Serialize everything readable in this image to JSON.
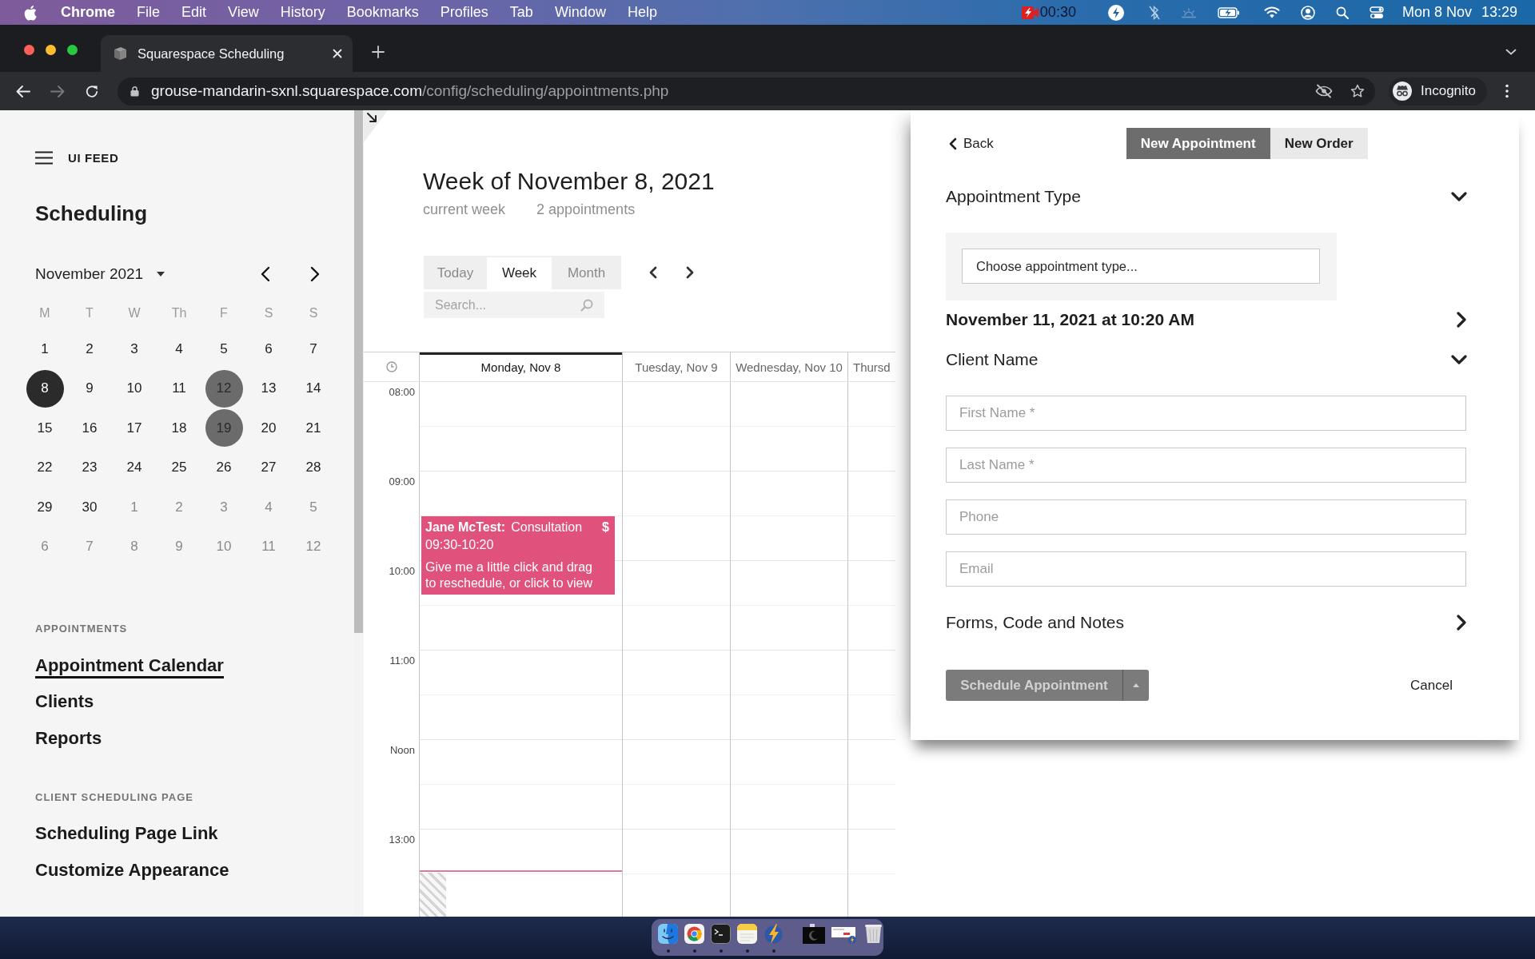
{
  "menu_bar": {
    "app": "Chrome",
    "menus": [
      "File",
      "Edit",
      "View",
      "History",
      "Bookmarks",
      "Profiles",
      "Tab",
      "Window",
      "Help"
    ],
    "recording_time": "00:30",
    "date": "Mon 8 Nov",
    "time": "13:29"
  },
  "browser": {
    "tab": {
      "title": "Squarespace Scheduling"
    },
    "url": {
      "host": "grouse-mandarin-sxnl.squarespace.com",
      "path": "/config/scheduling/appointments.php"
    },
    "profile": "Incognito"
  },
  "sidebar": {
    "brand": "UI FEED",
    "title": "Scheduling",
    "mini_calendar": {
      "month": "November 2021",
      "weekdays": [
        "M",
        "T",
        "W",
        "Th",
        "F",
        "S",
        "S"
      ],
      "weeks": [
        [
          {
            "day": "1",
            "other_month": false,
            "selected": false,
            "marked": false
          },
          {
            "day": "2",
            "other_month": false,
            "selected": false,
            "marked": false
          },
          {
            "day": "3",
            "other_month": false,
            "selected": false,
            "marked": false
          },
          {
            "day": "4",
            "other_month": false,
            "selected": false,
            "marked": false
          },
          {
            "day": "5",
            "other_month": false,
            "selected": false,
            "marked": false
          },
          {
            "day": "6",
            "other_month": false,
            "selected": false,
            "marked": false
          },
          {
            "day": "7",
            "other_month": false,
            "selected": false,
            "marked": false
          }
        ],
        [
          {
            "day": "8",
            "other_month": false,
            "selected": true,
            "marked": false
          },
          {
            "day": "9",
            "other_month": false,
            "selected": false,
            "marked": false
          },
          {
            "day": "10",
            "other_month": false,
            "selected": false,
            "marked": false
          },
          {
            "day": "11",
            "other_month": false,
            "selected": false,
            "marked": false
          },
          {
            "day": "12",
            "other_month": false,
            "selected": false,
            "marked": true
          },
          {
            "day": "13",
            "other_month": false,
            "selected": false,
            "marked": false
          },
          {
            "day": "14",
            "other_month": false,
            "selected": false,
            "marked": false
          }
        ],
        [
          {
            "day": "15",
            "other_month": false,
            "selected": false,
            "marked": false
          },
          {
            "day": "16",
            "other_month": false,
            "selected": false,
            "marked": false
          },
          {
            "day": "17",
            "other_month": false,
            "selected": false,
            "marked": false
          },
          {
            "day": "18",
            "other_month": false,
            "selected": false,
            "marked": false
          },
          {
            "day": "19",
            "other_month": false,
            "selected": false,
            "marked": true
          },
          {
            "day": "20",
            "other_month": false,
            "selected": false,
            "marked": false
          },
          {
            "day": "21",
            "other_month": false,
            "selected": false,
            "marked": false
          }
        ],
        [
          {
            "day": "22",
            "other_month": false,
            "selected": false,
            "marked": false
          },
          {
            "day": "23",
            "other_month": false,
            "selected": false,
            "marked": false
          },
          {
            "day": "24",
            "other_month": false,
            "selected": false,
            "marked": false
          },
          {
            "day": "25",
            "other_month": false,
            "selected": false,
            "marked": false
          },
          {
            "day": "26",
            "other_month": false,
            "selected": false,
            "marked": false
          },
          {
            "day": "27",
            "other_month": false,
            "selected": false,
            "marked": false
          },
          {
            "day": "28",
            "other_month": false,
            "selected": false,
            "marked": false
          }
        ],
        [
          {
            "day": "29",
            "other_month": false,
            "selected": false,
            "marked": false
          },
          {
            "day": "30",
            "other_month": false,
            "selected": false,
            "marked": false
          },
          {
            "day": "1",
            "other_month": true,
            "selected": false,
            "marked": false
          },
          {
            "day": "2",
            "other_month": true,
            "selected": false,
            "marked": false
          },
          {
            "day": "3",
            "other_month": true,
            "selected": false,
            "marked": false
          },
          {
            "day": "4",
            "other_month": true,
            "selected": false,
            "marked": false
          },
          {
            "day": "5",
            "other_month": true,
            "selected": false,
            "marked": false
          }
        ],
        [
          {
            "day": "6",
            "other_month": true,
            "selected": false,
            "marked": false
          },
          {
            "day": "7",
            "other_month": true,
            "selected": false,
            "marked": false
          },
          {
            "day": "8",
            "other_month": true,
            "selected": false,
            "marked": false
          },
          {
            "day": "9",
            "other_month": true,
            "selected": false,
            "marked": false
          },
          {
            "day": "10",
            "other_month": true,
            "selected": false,
            "marked": false
          },
          {
            "day": "11",
            "other_month": true,
            "selected": false,
            "marked": false
          },
          {
            "day": "12",
            "other_month": true,
            "selected": false,
            "marked": false
          }
        ]
      ]
    },
    "sections": [
      {
        "heading": "APPOINTMENTS",
        "items": [
          {
            "label": "Appointment Calendar",
            "selected": true
          },
          {
            "label": "Clients",
            "selected": false
          },
          {
            "label": "Reports",
            "selected": false
          }
        ]
      },
      {
        "heading": "CLIENT SCHEDULING PAGE",
        "items": [
          {
            "label": "Scheduling Page Link",
            "selected": false
          },
          {
            "label": "Customize Appearance",
            "selected": false
          }
        ]
      }
    ]
  },
  "calendar": {
    "title": "Week of November 8, 2021",
    "status": "current week",
    "count": "2 appointments",
    "views": [
      {
        "label": "Today",
        "selected": false
      },
      {
        "label": "Week",
        "selected": true
      },
      {
        "label": "Month",
        "selected": false
      }
    ],
    "search": {
      "placeholder": "Search..."
    },
    "days": [
      {
        "label": "Monday, Nov 8",
        "selected": true,
        "events": [
          {
            "client": "Jane McTest:",
            "service": "Consultation",
            "price_mark": "$",
            "time": "09:30-10:20",
            "note": "Give me a little click and drag to reschedule, or click to view"
          }
        ]
      },
      {
        "label": "Tuesday, Nov 9",
        "selected": false
      },
      {
        "label": "Wednesday, Nov 10",
        "selected": false
      },
      {
        "label": "Thursd",
        "selected": false
      }
    ],
    "hours": [
      "08:00",
      "09:00",
      "10:00",
      "11:00",
      "Noon",
      "13:00"
    ]
  },
  "appointment_panel": {
    "back": "Back",
    "modes": [
      {
        "label": "New Appointment",
        "selected": true
      },
      {
        "label": "New Order",
        "selected": false
      }
    ],
    "type_section": {
      "heading": "Appointment Type",
      "expanded": true,
      "select": "Choose appointment type..."
    },
    "date_time": {
      "label": "November 11, 2021 at 10:20 AM",
      "expanded": false
    },
    "client_section": {
      "heading": "Client Name",
      "expanded": true,
      "fields": [
        {
          "placeholder": "First Name *"
        },
        {
          "placeholder": "Last Name *"
        },
        {
          "placeholder": "Phone"
        },
        {
          "placeholder": "Email"
        }
      ]
    },
    "notes_section": {
      "heading": "Forms, Code and Notes",
      "expanded": false
    },
    "submit": {
      "label": "Schedule Appointment",
      "disabled": true
    },
    "cancel": "Cancel"
  },
  "dock": {
    "apps": [
      {
        "kind": "finder",
        "running": true
      },
      {
        "kind": "browser",
        "running": true
      },
      {
        "kind": "terminal",
        "running": true
      },
      {
        "kind": "notes",
        "running": true
      },
      {
        "kind": "lightning",
        "running": true
      }
    ],
    "others": [
      {
        "kind": "window"
      },
      {
        "kind": "dialog"
      },
      {
        "kind": "trash"
      }
    ]
  }
}
